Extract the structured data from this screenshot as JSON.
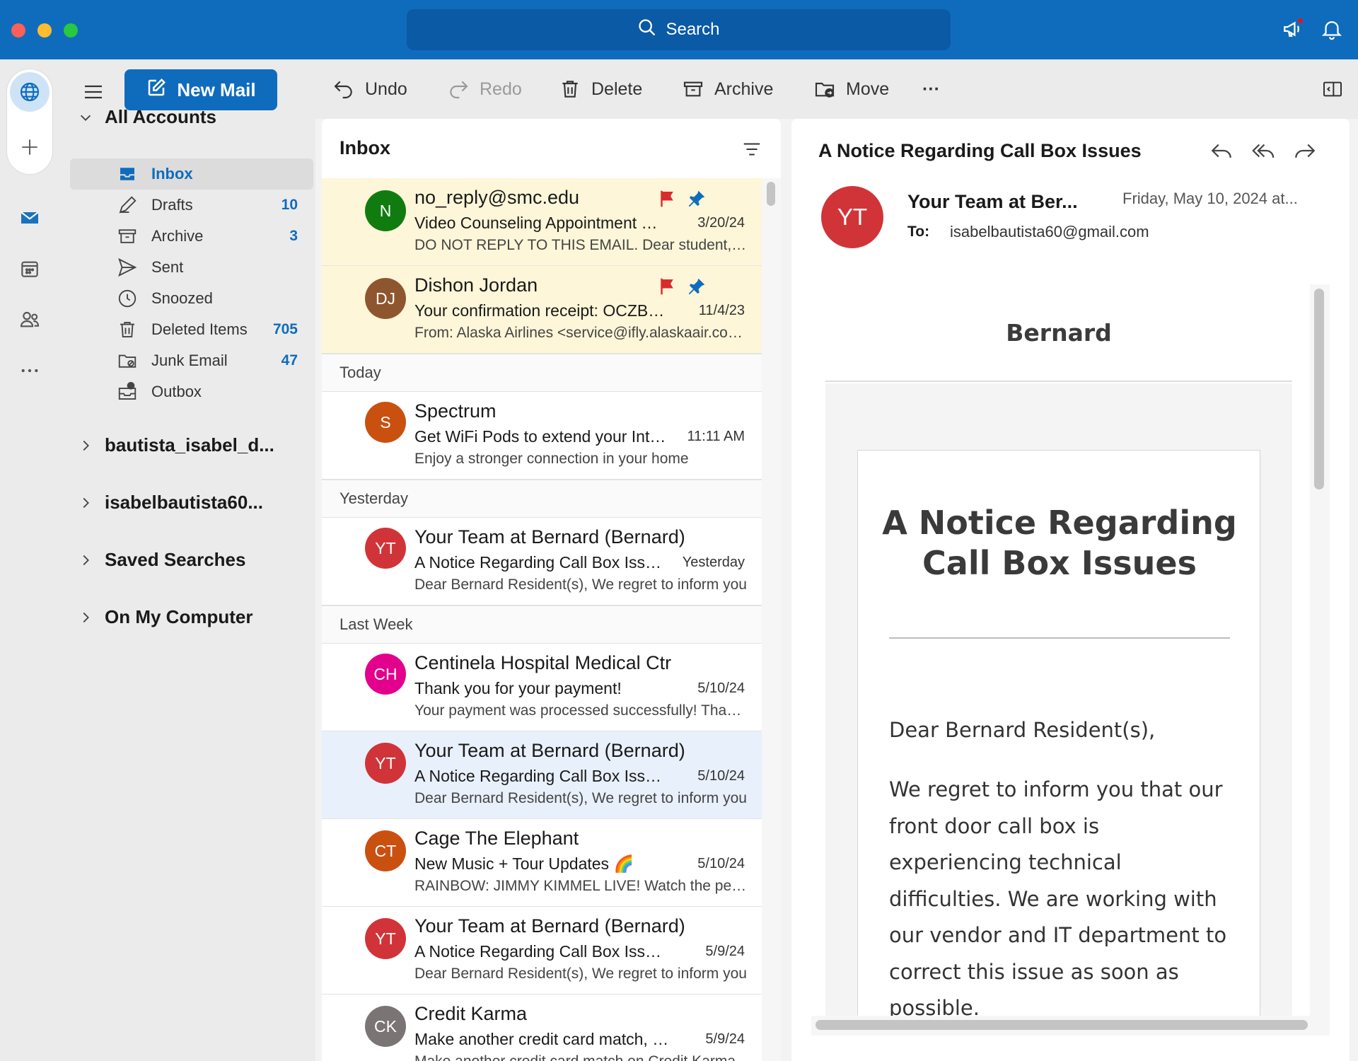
{
  "titlebar": {
    "search_label": "Search"
  },
  "folders": {
    "new_mail": "New Mail",
    "all_accounts": "All Accounts",
    "items": [
      {
        "label": "Inbox",
        "count": ""
      },
      {
        "label": "Drafts",
        "count": "10"
      },
      {
        "label": "Archive",
        "count": "3"
      },
      {
        "label": "Sent",
        "count": ""
      },
      {
        "label": "Snoozed",
        "count": ""
      },
      {
        "label": "Deleted Items",
        "count": "705"
      },
      {
        "label": "Junk Email",
        "count": "47"
      },
      {
        "label": "Outbox",
        "count": ""
      }
    ],
    "accounts": [
      "bautista_isabel_d...",
      "isabelbautista60...",
      "Saved Searches",
      "On My Computer"
    ]
  },
  "toolbar": {
    "undo": "Undo",
    "redo": "Redo",
    "delete": "Delete",
    "archive": "Archive",
    "move": "Move",
    "more": "···"
  },
  "list": {
    "title": "Inbox",
    "groups": [
      "Today",
      "Yesterday",
      "Last Week"
    ],
    "messages": [
      {
        "initials": "N",
        "sender": "no_reply@smc.edu",
        "subject": "Video Counseling Appointment Confirmation",
        "date": "3/20/24",
        "preview": "DO NOT REPLY TO THIS EMAIL. Dear student, your appointment",
        "color": "#107c10"
      },
      {
        "initials": "DJ",
        "sender": "Dishon Jordan",
        "subject": "Your confirmation receipt: OCZBXK",
        "date": "11/4/23",
        "preview": "From: Alaska Airlines <service@ifly.alaskaair.com>",
        "color": "#8e562e"
      },
      {
        "initials": "S",
        "sender": "Spectrum",
        "subject": "Get WiFi Pods to extend your Internet",
        "date": "11:11 AM",
        "preview": "Enjoy a stronger connection in your home",
        "color": "#ca5010"
      },
      {
        "initials": "YT",
        "sender": "Your Team at Bernard (Bernard)",
        "subject": "A Notice Regarding Call Box Issues",
        "date": "Yesterday",
        "preview": "Dear Bernard Resident(s), We regret to inform you",
        "color": "#d13438"
      },
      {
        "initials": "CH",
        "sender": "Centinela Hospital Medical Ctr",
        "subject": "Thank you for your payment!",
        "date": "5/10/24",
        "preview": "Your payment was processed successfully! Thank you",
        "color": "#e3008c"
      },
      {
        "initials": "YT",
        "sender": "Your Team at Bernard (Bernard)",
        "subject": "A Notice Regarding Call Box Issues",
        "date": "5/10/24",
        "preview": "Dear Bernard Resident(s), We regret to inform you",
        "color": "#d13438"
      },
      {
        "initials": "CT",
        "sender": "Cage The Elephant",
        "subject": "New Music + Tour Updates 🌈",
        "date": "5/10/24",
        "preview": "RAINBOW: JIMMY KIMMEL LIVE! Watch the performance",
        "color": "#ca5010"
      },
      {
        "initials": "YT",
        "sender": "Your Team at Bernard (Bernard)",
        "subject": "A Notice Regarding Call Box Issues",
        "date": "5/9/24",
        "preview": "Dear Bernard Resident(s), We regret to inform you",
        "color": "#d13438"
      },
      {
        "initials": "CK",
        "sender": "Credit Karma",
        "subject": "Make another credit card match, Isabel",
        "date": "5/9/24",
        "preview": "Make another credit card match on Credit Karma",
        "color": "#7a7574"
      }
    ]
  },
  "reader": {
    "subject": "A Notice Regarding Call Box Issues",
    "avatar": "YT",
    "from": "Your Team at Ber...",
    "date": "Friday, May 10, 2024 at...",
    "to_label": "To:",
    "to": "isabelbautista60@gmail.com",
    "body": {
      "brand": "Bernard",
      "title": "A Notice Regarding Call Box Issues",
      "greeting": "Dear Bernard Resident(s),",
      "paragraph": "We regret to inform you that our front door call box is experiencing technical difficulties. We are working with our vendor and IT department to correct this issue as soon as possible."
    }
  }
}
